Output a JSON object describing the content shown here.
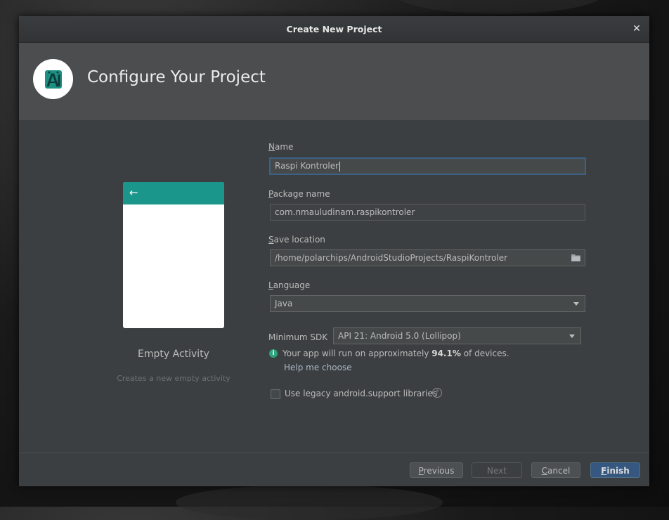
{
  "window": {
    "title": "Create New Project"
  },
  "header": {
    "title": "Configure Your Project"
  },
  "template": {
    "name": "Empty Activity",
    "description": "Creates a new empty activity"
  },
  "form": {
    "name": {
      "label_first": "N",
      "label_rest": "ame",
      "value": "Raspi Kontroler"
    },
    "package": {
      "label_first": "P",
      "label_rest": "ackage name",
      "value": "com.nmauludinam.raspikontroler"
    },
    "save_location": {
      "label_first": "S",
      "label_rest": "ave location",
      "value": "/home/polarchips/AndroidStudioProjects/RaspiKontroler"
    },
    "language": {
      "label_first": "L",
      "label_rest": "anguage",
      "value": "Java"
    },
    "min_sdk": {
      "label": "Minimum SDK",
      "value": "API 21: Android 5.0 (Lollipop)"
    },
    "info": {
      "prefix": "Your app will run on approximately ",
      "percent": "94.1%",
      "suffix": " of devices."
    },
    "help_link": "Help me choose",
    "legacy": {
      "label": "Use legacy android.support libraries",
      "checked": false
    }
  },
  "footer": {
    "previous": {
      "first": "P",
      "rest": "revious"
    },
    "next": "Next",
    "cancel": {
      "first": "C",
      "rest": "ancel"
    },
    "finish": {
      "first": "F",
      "rest": "inish"
    }
  }
}
